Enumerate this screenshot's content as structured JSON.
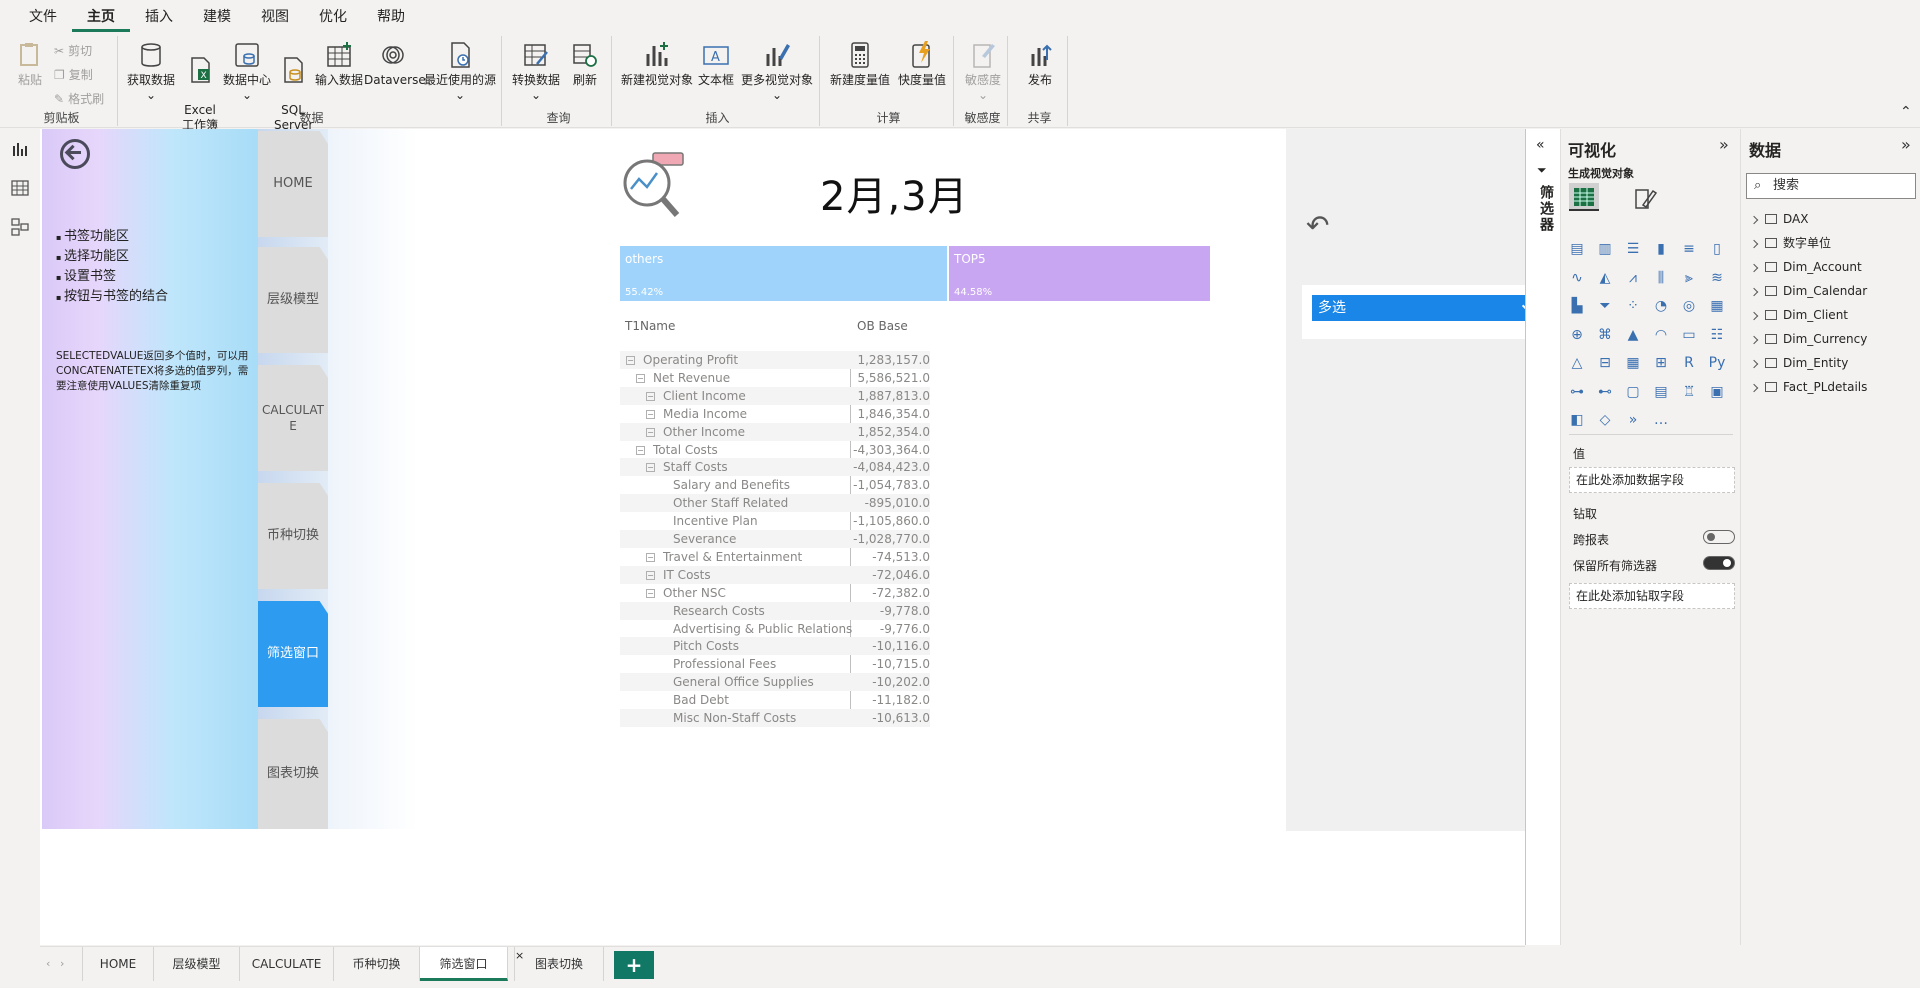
{
  "menu": [
    "文件",
    "主页",
    "插入",
    "建模",
    "视图",
    "优化",
    "帮助"
  ],
  "ribbon": {
    "clipboard": {
      "paste": "粘贴",
      "cut": "剪切",
      "copy": "复制",
      "format": "格式刷",
      "group": "剪贴板"
    },
    "data": {
      "get_data": "获取数据",
      "excel": "Excel\n工作簿",
      "hub": "数据中心",
      "sql": "SQL\nServer",
      "enter": "输入数据",
      "dataverse": "Dataverse",
      "recent": "最近使用的源",
      "group": "数据"
    },
    "query": {
      "transform": "转换数据",
      "refresh": "刷新",
      "group": "查询"
    },
    "insert": {
      "new_visual": "新建视觉对象",
      "textbox": "文本框",
      "more_visuals": "更多视觉对象",
      "group": "插入"
    },
    "calc": {
      "new_measure": "新建度量值",
      "quick_measure": "快度量值",
      "group": "计算"
    },
    "sensitivity": {
      "label": "敏感度",
      "group": "敏感度"
    },
    "share": {
      "publish": "发布",
      "group": "共享"
    }
  },
  "left_panel": {
    "bullets": [
      "书签功能区",
      "选择功能区",
      "设置书签",
      "按钮与书签的结合"
    ],
    "note": "SELECTEDVALUE返回多个值时，可以用CONCATENATETEX将多选的值罗列，需要注意使用VALUES清除重复项"
  },
  "nav_tabs": [
    "HOME",
    "层级模型",
    "CALCULATE",
    "币种切换",
    "筛选窗口",
    "图表切换"
  ],
  "report_title": "2月,3月",
  "split_bar": [
    {
      "name": "others",
      "pct": "55.42%",
      "value": 55.42,
      "color": "#9fd3fb"
    },
    {
      "name": "TOP5",
      "pct": "44.58%",
      "value": 44.58,
      "color": "#c9a6f2"
    }
  ],
  "matrix": {
    "col1": "T1Name",
    "col2": "OB Base",
    "rows": [
      {
        "name": "Operating Profit",
        "value": "1,283,157.0",
        "level": 0,
        "expand": true
      },
      {
        "name": "Net Revenue",
        "value": "5,586,521.0",
        "level": 1,
        "expand": true
      },
      {
        "name": "Client Income",
        "value": "1,887,813.0",
        "level": 2,
        "expand": true
      },
      {
        "name": "Media Income",
        "value": "1,846,354.0",
        "level": 2,
        "expand": true
      },
      {
        "name": "Other Income",
        "value": "1,852,354.0",
        "level": 2,
        "expand": true
      },
      {
        "name": "Total Costs",
        "value": "-4,303,364.0",
        "level": 1,
        "expand": true
      },
      {
        "name": "Staff Costs",
        "value": "-4,084,423.0",
        "level": 2,
        "expand": true
      },
      {
        "name": "Salary and Benefits",
        "value": "-1,054,783.0",
        "level": 3,
        "expand": false
      },
      {
        "name": "Other Staff Related",
        "value": "-895,010.0",
        "level": 3,
        "expand": false
      },
      {
        "name": "Incentive Plan",
        "value": "-1,105,860.0",
        "level": 3,
        "expand": false
      },
      {
        "name": "Severance",
        "value": "-1,028,770.0",
        "level": 3,
        "expand": false
      },
      {
        "name": "Travel & Entertainment",
        "value": "-74,513.0",
        "level": 2,
        "expand": true
      },
      {
        "name": "IT Costs",
        "value": "-72,046.0",
        "level": 2,
        "expand": true
      },
      {
        "name": "Other NSC",
        "value": "-72,382.0",
        "level": 2,
        "expand": true
      },
      {
        "name": "Research Costs",
        "value": "-9,778.0",
        "level": 3,
        "expand": false
      },
      {
        "name": "Advertising & Public Relations",
        "value": "-9,776.0",
        "level": 3,
        "expand": false
      },
      {
        "name": "Pitch Costs",
        "value": "-10,116.0",
        "level": 3,
        "expand": false
      },
      {
        "name": "Professional Fees",
        "value": "-10,715.0",
        "level": 3,
        "expand": false
      },
      {
        "name": "General Office Supplies",
        "value": "-10,202.0",
        "level": 3,
        "expand": false
      },
      {
        "name": "Bad Debt",
        "value": "-11,182.0",
        "level": 3,
        "expand": false
      },
      {
        "name": "Misc Non-Staff Costs",
        "value": "-10,613.0",
        "level": 3,
        "expand": false
      }
    ]
  },
  "dropdown": {
    "selected": "多选"
  },
  "page_tabs": [
    "HOME",
    "层级模型",
    "CALCULATE",
    "币种切换",
    "筛选窗口",
    "图表切换"
  ],
  "active_page_tab": "筛选窗口",
  "filter_rail": {
    "label": "筛选器"
  },
  "viz_pane": {
    "title": "可视化",
    "sub": "生成视觉对象",
    "values_label": "值",
    "values_well": "在此处添加数据字段",
    "drill": "钻取",
    "cross_report": "跨报表",
    "keep_filters": "保留所有筛选器",
    "drill_well": "在此处添加钻取字段"
  },
  "data_pane": {
    "title": "数据",
    "search": "搜索",
    "tables": [
      "DAX",
      "数字单位",
      "Dim_Account",
      "Dim_Calendar",
      "Dim_Client",
      "Dim_Currency",
      "Dim_Entity",
      "Fact_PLdetails"
    ]
  }
}
